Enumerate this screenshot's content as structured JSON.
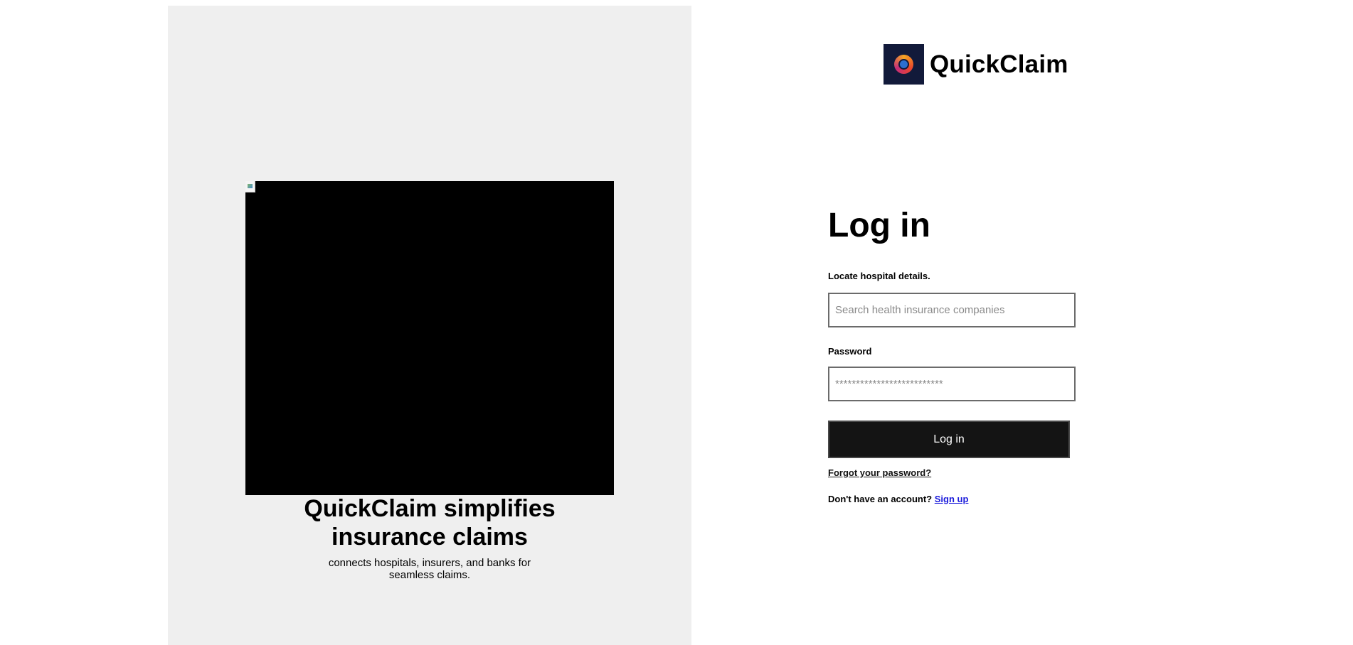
{
  "brand": {
    "name": "QuickClaim",
    "logo_icon": "quickclaim-logo-icon",
    "logo_bg_color": "#121a3a"
  },
  "hero": {
    "image_alt_icon": "broken-image-icon",
    "title": "QuickClaim simplifies insurance claims",
    "subtitle": "connects hospitals, insurers, and banks for seamless claims."
  },
  "login": {
    "title": "Log in",
    "hospital_field": {
      "label": "Locate hospital details.",
      "placeholder": "Search health insurance companies",
      "value": ""
    },
    "password_field": {
      "label": "Password",
      "placeholder": "**************************",
      "value": ""
    },
    "submit_label": "Log in",
    "forgot_password": "Forgot your password?",
    "no_account_text": "Don't have an account?",
    "signup_link": "Sign up"
  },
  "colors": {
    "left_panel_bg": "#efefef",
    "button_bg": "#141414",
    "link_blue": "#1a1adb"
  }
}
